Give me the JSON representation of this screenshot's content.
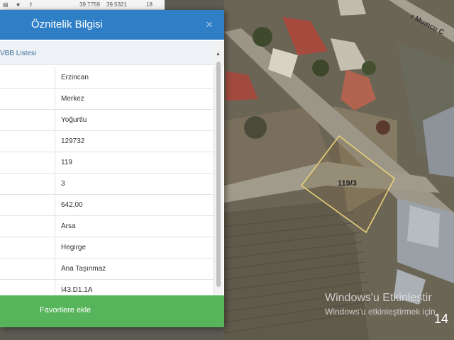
{
  "toolbar": {
    "coords_a": "39.7759",
    "coords_b": "39.5321",
    "zoom": "18"
  },
  "panel": {
    "title": "Öznitelik Bilgisi",
    "close_icon": "close-icon",
    "tab_label": "VBB Listesi",
    "rows": [
      "Erzincan",
      "Merkez",
      "Yoğurtlu",
      "129732",
      "119",
      "3",
      "642,00",
      "Arsa",
      "Hegirge",
      "Ana Taşınmaz",
      "İ43.D1.1A"
    ],
    "favorite_button": "Favorilere ekle"
  },
  "map": {
    "parcel_label": "119/3",
    "road_label": "r Mumcu C",
    "parcel_outline_color": "#e8d07a",
    "page_number": "14"
  },
  "watermark": {
    "title": "Windows'u Etkinleştir",
    "subtitle": "Windows'u etkinleştirmek için"
  },
  "colors": {
    "header": "#2f7fc6",
    "favorite_button": "#56b45b"
  }
}
